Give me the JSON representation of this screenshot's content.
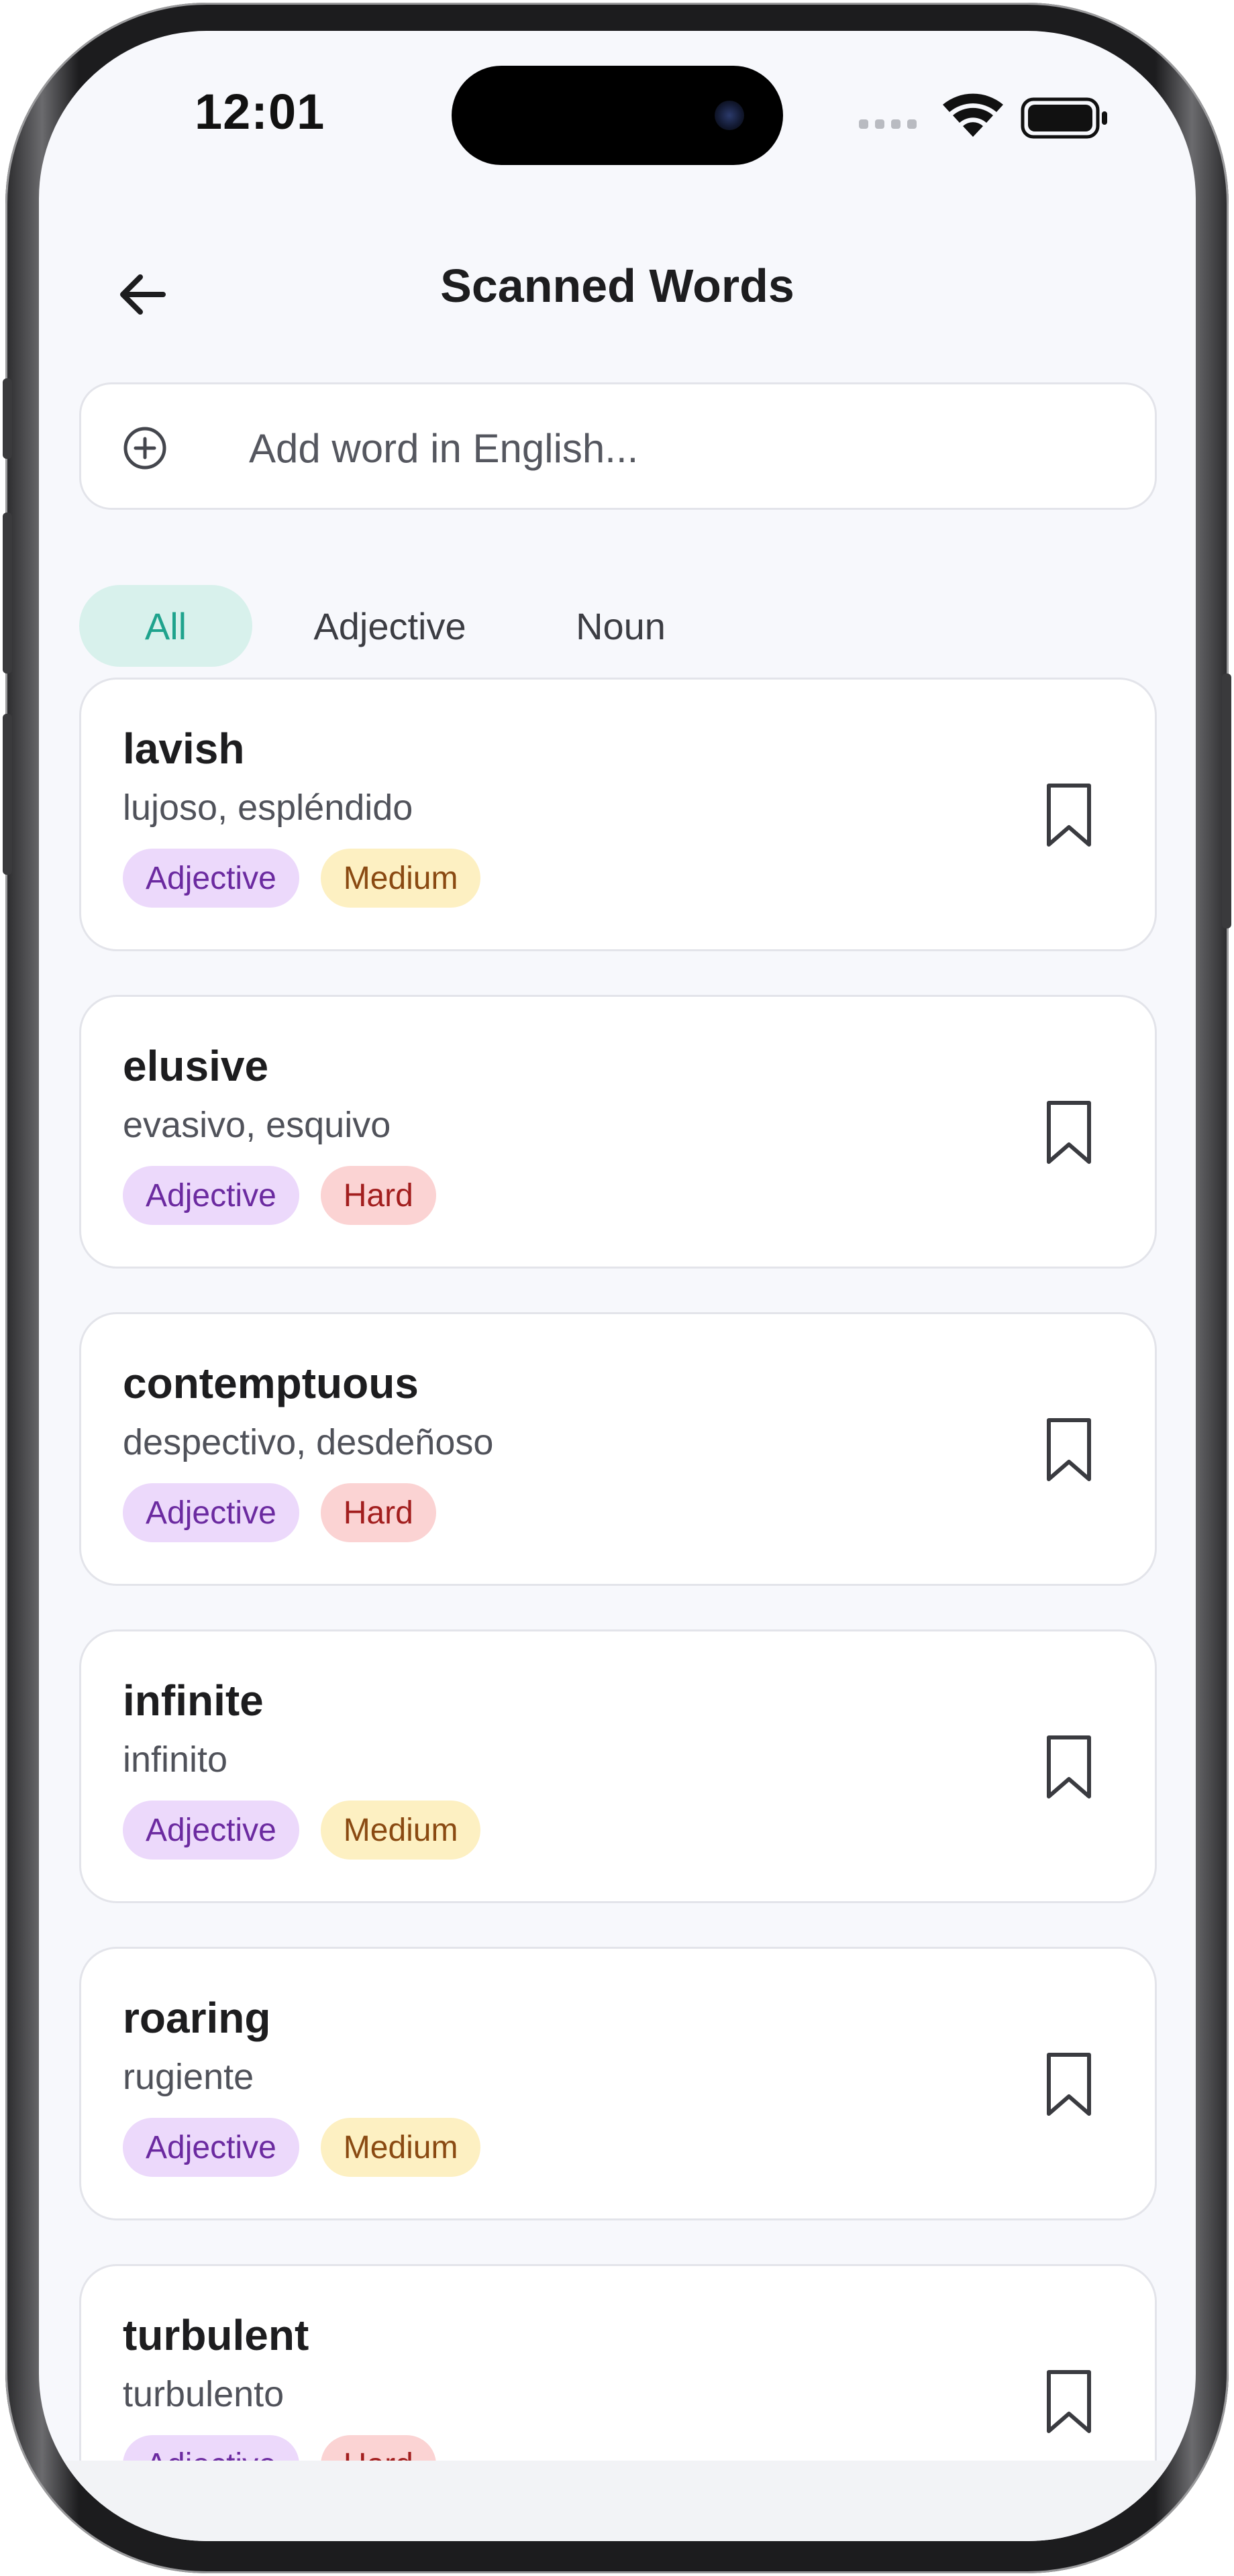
{
  "status_bar": {
    "time": "12:01"
  },
  "header": {
    "title": "Scanned Words"
  },
  "search": {
    "placeholder": "Add word in English..."
  },
  "filters": [
    {
      "label": "All",
      "active": true
    },
    {
      "label": "Adjective",
      "active": false
    },
    {
      "label": "Noun",
      "active": false
    }
  ],
  "words": [
    {
      "word": "lavish",
      "translation": "lujoso, espléndido",
      "type": "Adjective",
      "difficulty": "Medium"
    },
    {
      "word": "elusive",
      "translation": "evasivo, esquivo",
      "type": "Adjective",
      "difficulty": "Hard"
    },
    {
      "word": "contemptuous",
      "translation": "despectivo, desdeñoso",
      "type": "Adjective",
      "difficulty": "Hard"
    },
    {
      "word": "infinite",
      "translation": "infinito",
      "type": "Adjective",
      "difficulty": "Medium"
    },
    {
      "word": "roaring",
      "translation": "rugiente",
      "type": "Adjective",
      "difficulty": "Medium"
    },
    {
      "word": "turbulent",
      "translation": "turbulento",
      "type": "Adjective",
      "difficulty": "Hard"
    }
  ],
  "colors": {
    "accent": "#1fa38d",
    "accent_bg": "#d8f1ec",
    "adjective_bg": "#ecd9fb",
    "adjective_text": "#6b2aa0",
    "medium_bg": "#fdf0c2",
    "medium_text": "#8a4a12",
    "hard_bg": "#fbd3d3",
    "hard_text": "#a21e1e"
  },
  "icons": {
    "back": "arrow-left-icon",
    "add": "plus-circle-icon",
    "bookmark": "bookmark-icon",
    "signal": "cellular-signal-icon",
    "wifi": "wifi-icon",
    "battery": "battery-icon"
  }
}
